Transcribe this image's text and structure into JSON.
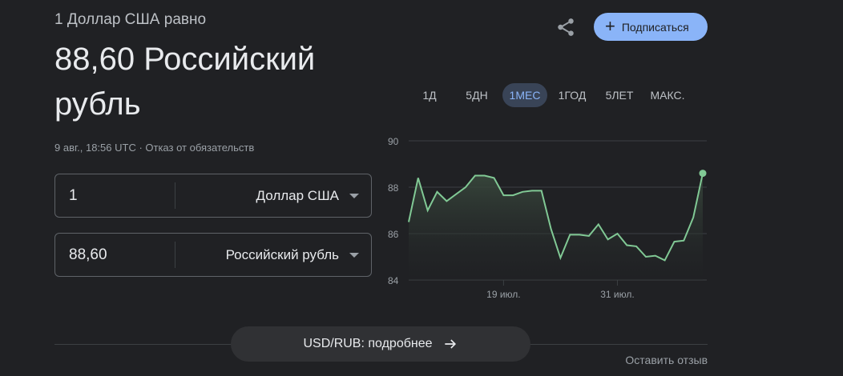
{
  "header": {
    "subtitle": "1 Доллар США равно",
    "value": "88,60 Российский рубль",
    "meta": "9 авг., 18:56 UTC · Отказ от обязательств"
  },
  "converter": {
    "from": {
      "amount": "1",
      "currency": "Доллар США"
    },
    "to": {
      "amount": "88,60",
      "currency": "Российский рубль"
    }
  },
  "actions": {
    "share_icon": "share-icon",
    "subscribe_label": "Подписаться"
  },
  "tabs": [
    {
      "label": "1Д",
      "active": false
    },
    {
      "label": "5ДН",
      "active": false
    },
    {
      "label": "1МЕС",
      "active": true
    },
    {
      "label": "1ГОД",
      "active": false
    },
    {
      "label": "5ЛЕТ",
      "active": false
    },
    {
      "label": "МАКС.",
      "active": false
    }
  ],
  "chart_data": {
    "type": "area",
    "yticks": [
      "84",
      "86",
      "88",
      "90"
    ],
    "ylim": [
      84,
      90
    ],
    "xtick_labels": [
      {
        "label": "19 июл.",
        "index": 10
      },
      {
        "label": "31 июл.",
        "index": 22
      }
    ],
    "grid": true,
    "series": [
      {
        "values": [
          86.5,
          88.4,
          87.0,
          87.8,
          87.4,
          87.7,
          88.0,
          88.5,
          88.5,
          88.4,
          87.65,
          87.65,
          87.8,
          87.85,
          87.85,
          86.2,
          84.95,
          85.95,
          85.95,
          85.9,
          86.4,
          85.75,
          86.0,
          85.5,
          85.45,
          85.0,
          85.05,
          84.85,
          85.65,
          85.7,
          86.7,
          88.6
        ]
      }
    ],
    "colors": {
      "line": "#81c995",
      "fill_top": "#3a4a3e",
      "grid": "#3c4043",
      "tick": "#9aa0a6"
    }
  },
  "footer": {
    "detail_label": "USD/RUB: подробнее",
    "arrow_icon": "arrow-right-icon",
    "feedback": "Оставить отзыв"
  }
}
